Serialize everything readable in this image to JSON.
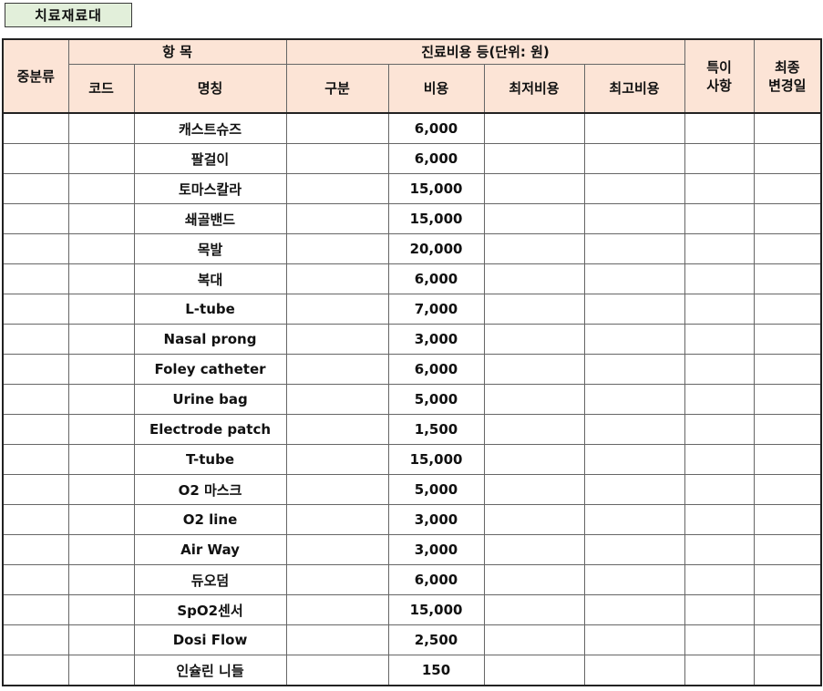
{
  "title": "치료재료대",
  "header": {
    "category": "중분류",
    "item_group": "항 목",
    "fee_group": "진료비용 등(단위: 원)",
    "note": "특이\n사항",
    "last_changed": "최종\n변경일",
    "code": "코드",
    "name": "명칭",
    "division": "구분",
    "cost": "비용",
    "min_cost": "최저비용",
    "max_cost": "최고비용"
  },
  "rows": [
    {
      "name": "캐스트슈즈",
      "cost": "6,000"
    },
    {
      "name": "팔걸이",
      "cost": "6,000"
    },
    {
      "name": "토마스칼라",
      "cost": "15,000"
    },
    {
      "name": "쇄골밴드",
      "cost": "15,000"
    },
    {
      "name": "목발",
      "cost": "20,000"
    },
    {
      "name": "복대",
      "cost": "6,000"
    },
    {
      "name": "L-tube",
      "cost": "7,000"
    },
    {
      "name": "Nasal prong",
      "cost": "3,000"
    },
    {
      "name": "Foley catheter",
      "cost": "6,000"
    },
    {
      "name": "Urine bag",
      "cost": "5,000"
    },
    {
      "name": "Electrode patch",
      "cost": "1,500"
    },
    {
      "name": "T-tube",
      "cost": "15,000"
    },
    {
      "name": "O2 마스크",
      "cost": "5,000"
    },
    {
      "name": "O2 line",
      "cost": "3,000"
    },
    {
      "name": "Air Way",
      "cost": "3,000"
    },
    {
      "name": "듀오덤",
      "cost": "6,000"
    },
    {
      "name": "SpO2센서",
      "cost": "15,000"
    },
    {
      "name": "Dosi Flow",
      "cost": "2,500"
    },
    {
      "name": "인슐린 니들",
      "cost": "150"
    }
  ]
}
